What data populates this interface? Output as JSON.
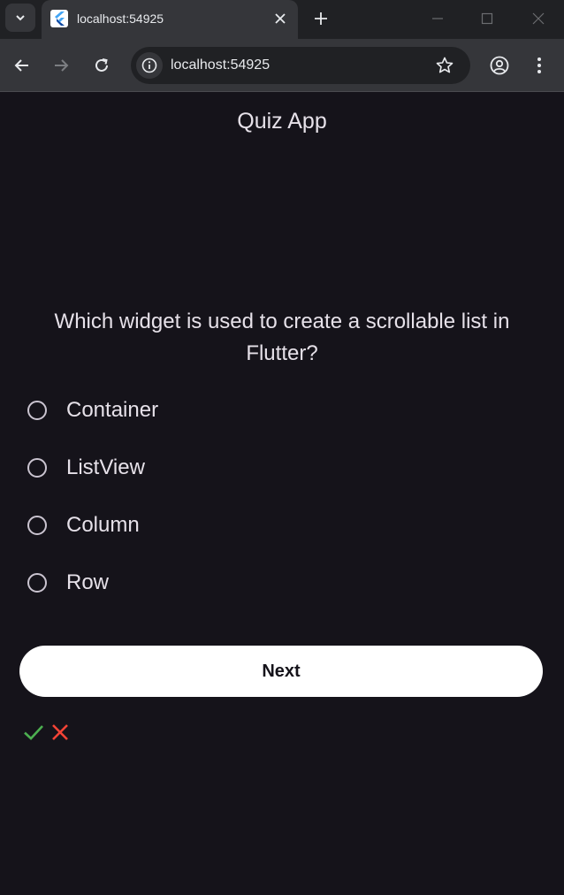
{
  "browser": {
    "tab_title": "localhost:54925",
    "url": "localhost:54925"
  },
  "app": {
    "title": "Quiz App",
    "question": "Which widget is used to create a scrollable list in Flutter?",
    "options": [
      {
        "label": "Container",
        "selected": false
      },
      {
        "label": "ListView",
        "selected": false
      },
      {
        "label": "Column",
        "selected": false
      },
      {
        "label": "Row",
        "selected": false
      }
    ],
    "next_label": "Next",
    "score_marks": [
      {
        "icon": "check-icon",
        "color": "#4caf50"
      },
      {
        "icon": "close-icon",
        "color": "#f44336"
      }
    ]
  },
  "colors": {
    "background": "#15131a",
    "text": "#e6e1e9",
    "button_bg": "#ffffff"
  }
}
